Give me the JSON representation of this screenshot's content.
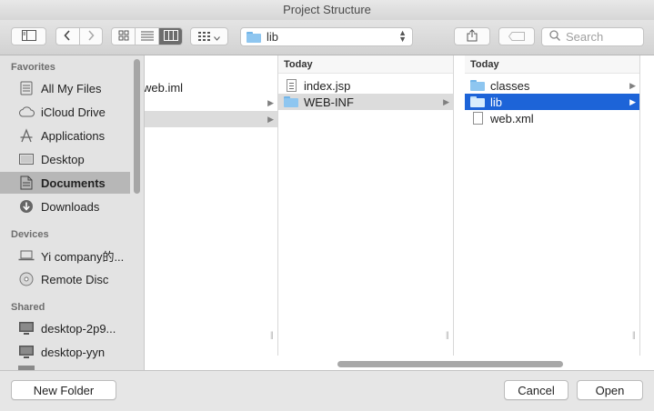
{
  "window": {
    "title": "Project Structure"
  },
  "toolbar": {
    "path_label": "lib",
    "search_placeholder": "Search"
  },
  "sidebar": {
    "favorites_header": "Favorites",
    "favorites": [
      {
        "label": "All My Files",
        "icon": "all-files-icon"
      },
      {
        "label": "iCloud Drive",
        "icon": "cloud-icon"
      },
      {
        "label": "Applications",
        "icon": "applications-icon"
      },
      {
        "label": "Desktop",
        "icon": "desktop-icon"
      },
      {
        "label": "Documents",
        "icon": "documents-icon",
        "selected": true
      },
      {
        "label": "Downloads",
        "icon": "downloads-icon"
      }
    ],
    "devices_header": "Devices",
    "devices": [
      {
        "label": "Yi company的...",
        "icon": "laptop-icon"
      },
      {
        "label": "Remote Disc",
        "icon": "disc-icon"
      }
    ],
    "shared_header": "Shared",
    "shared": [
      {
        "label": "desktop-2p9...",
        "icon": "monitor-icon"
      },
      {
        "label": "desktop-yyn",
        "icon": "monitor-icon"
      }
    ]
  },
  "columns": [
    {
      "header": "",
      "rows": [
        {
          "label": "web.iml",
          "type": "file"
        },
        {
          "label": "",
          "type": "folder",
          "arrow": true
        },
        {
          "label": "",
          "type": "folder",
          "arrow": true,
          "state": "grey"
        }
      ]
    },
    {
      "header": "Today",
      "rows": [
        {
          "label": "index.jsp",
          "type": "file-text"
        },
        {
          "label": "WEB-INF",
          "type": "folder",
          "arrow": true,
          "state": "grey"
        }
      ]
    },
    {
      "header": "Today",
      "rows": [
        {
          "label": "classes",
          "type": "folder",
          "arrow": true
        },
        {
          "label": "lib",
          "type": "folder",
          "arrow": true,
          "state": "blue"
        },
        {
          "label": "web.xml",
          "type": "file"
        }
      ]
    }
  ],
  "buttons": {
    "new_folder": "New Folder",
    "cancel": "Cancel",
    "open": "Open"
  },
  "colors": {
    "selection_blue": "#1d64d8",
    "folder_blue": "#8ec6f0"
  }
}
